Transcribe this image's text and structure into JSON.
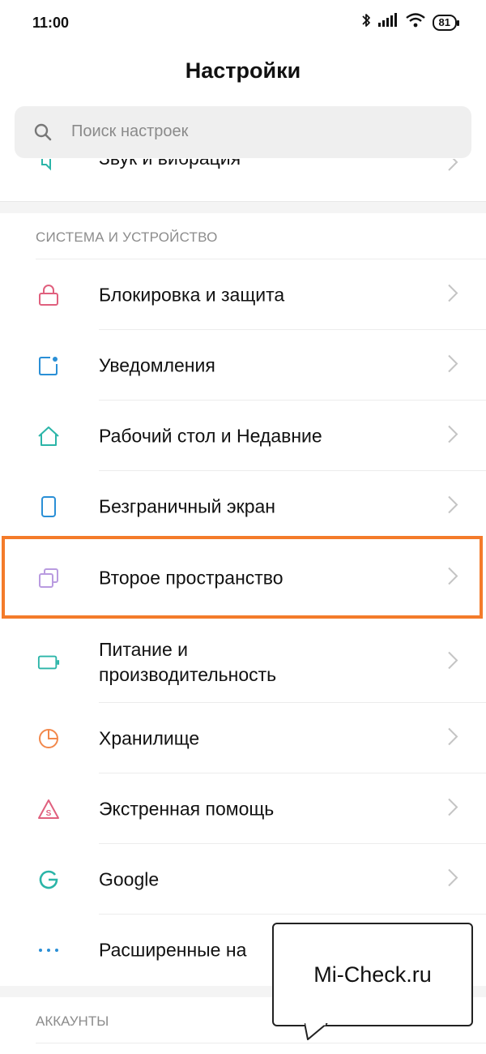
{
  "status_bar": {
    "time": "11:00",
    "battery": "81"
  },
  "header": {
    "title": "Настройки"
  },
  "search": {
    "placeholder": "Поиск настроек"
  },
  "partial_item": {
    "label": "Звук и вибрация"
  },
  "section_system": {
    "title": "СИСТЕМА И УСТРОЙСТВО"
  },
  "items": [
    {
      "label": "Блокировка и защита",
      "icon": "lock-icon",
      "color": "#e0607e"
    },
    {
      "label": "Уведомления",
      "icon": "notification-icon",
      "color": "#2a8fd6"
    },
    {
      "label": "Рабочий стол и Недавние",
      "icon": "home-icon",
      "color": "#2bb5a8"
    },
    {
      "label": "Безграничный экран",
      "icon": "phone-icon",
      "color": "#2a8fd6"
    },
    {
      "label": "Второе пространство",
      "icon": "second-space-icon",
      "color": "#b99be0"
    },
    {
      "label": "Питание и производительность",
      "label_line1": "Питание и",
      "label_line2": "производительность",
      "icon": "battery-icon",
      "color": "#2bb5a8"
    },
    {
      "label": "Хранилище",
      "icon": "storage-pie-icon",
      "color": "#f2884b"
    },
    {
      "label": "Экстренная помощь",
      "icon": "sos-icon",
      "color": "#e0607e"
    },
    {
      "label": "Google",
      "icon": "google-icon",
      "color": "#2bb5a8"
    },
    {
      "label": "Расширенные на",
      "icon": "more-dots-icon",
      "color": "#2a8fd6"
    }
  ],
  "section_accounts": {
    "title": "АККАУНТЫ"
  },
  "watermark": {
    "text": "Mi-Check.ru"
  },
  "colors": {
    "highlight": "#f47b2a",
    "section_text": "#8c8c8c",
    "chevron": "#c4c4c4"
  }
}
